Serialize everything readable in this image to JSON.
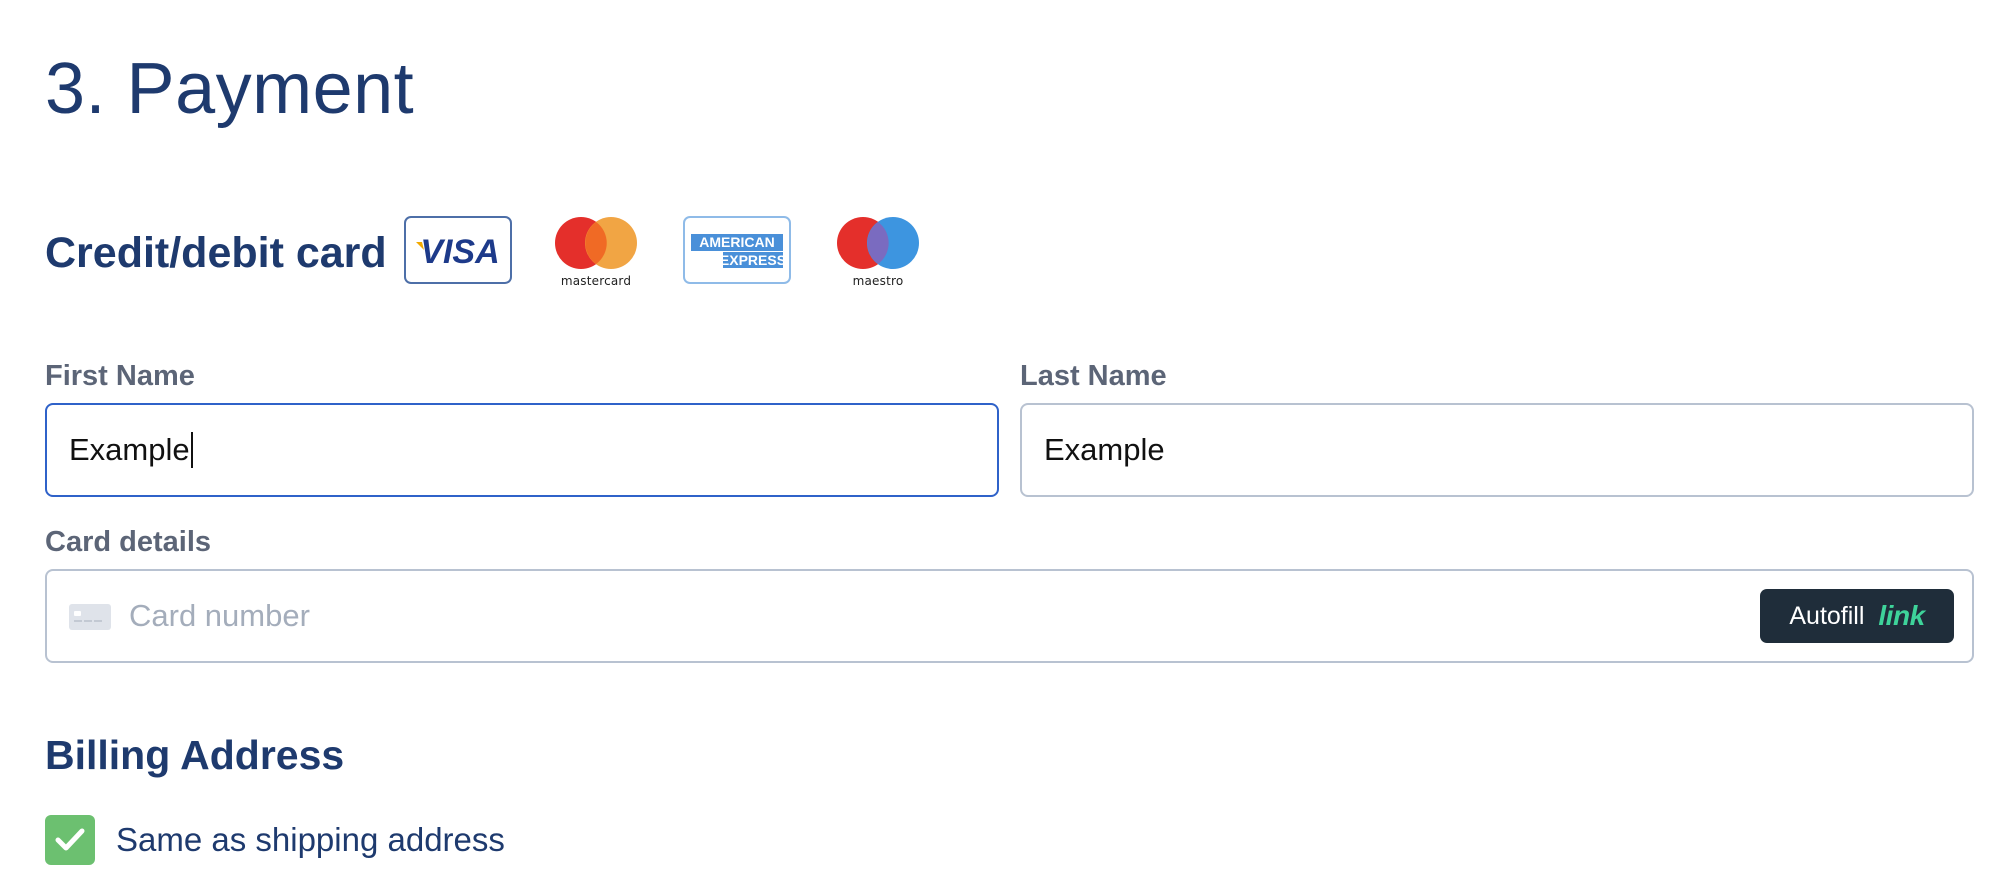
{
  "section": {
    "title": "3. Payment"
  },
  "card": {
    "heading": "Credit/debit card",
    "logos": [
      {
        "name": "visa",
        "text": "VISA"
      },
      {
        "name": "mastercard",
        "text": "mastercard"
      },
      {
        "name": "amex",
        "text": "AMERICAN EXPRESS"
      },
      {
        "name": "maestro",
        "text": "maestro"
      }
    ]
  },
  "form": {
    "first_name_label": "First Name",
    "first_name_value": "Example",
    "last_name_label": "Last Name",
    "last_name_value": "Example",
    "card_details_label": "Card details",
    "card_number_placeholder": "Card number",
    "autofill_label": "Autofill",
    "autofill_brand": "link"
  },
  "billing": {
    "heading": "Billing Address",
    "same_as_shipping_label": "Same as shipping address",
    "same_as_shipping_checked": true
  },
  "colors": {
    "heading": "#1e3a6e",
    "label": "#5c6577",
    "focus_border": "#2f62c9",
    "checkbox": "#6cc070",
    "link_brand": "#3ed39a"
  }
}
